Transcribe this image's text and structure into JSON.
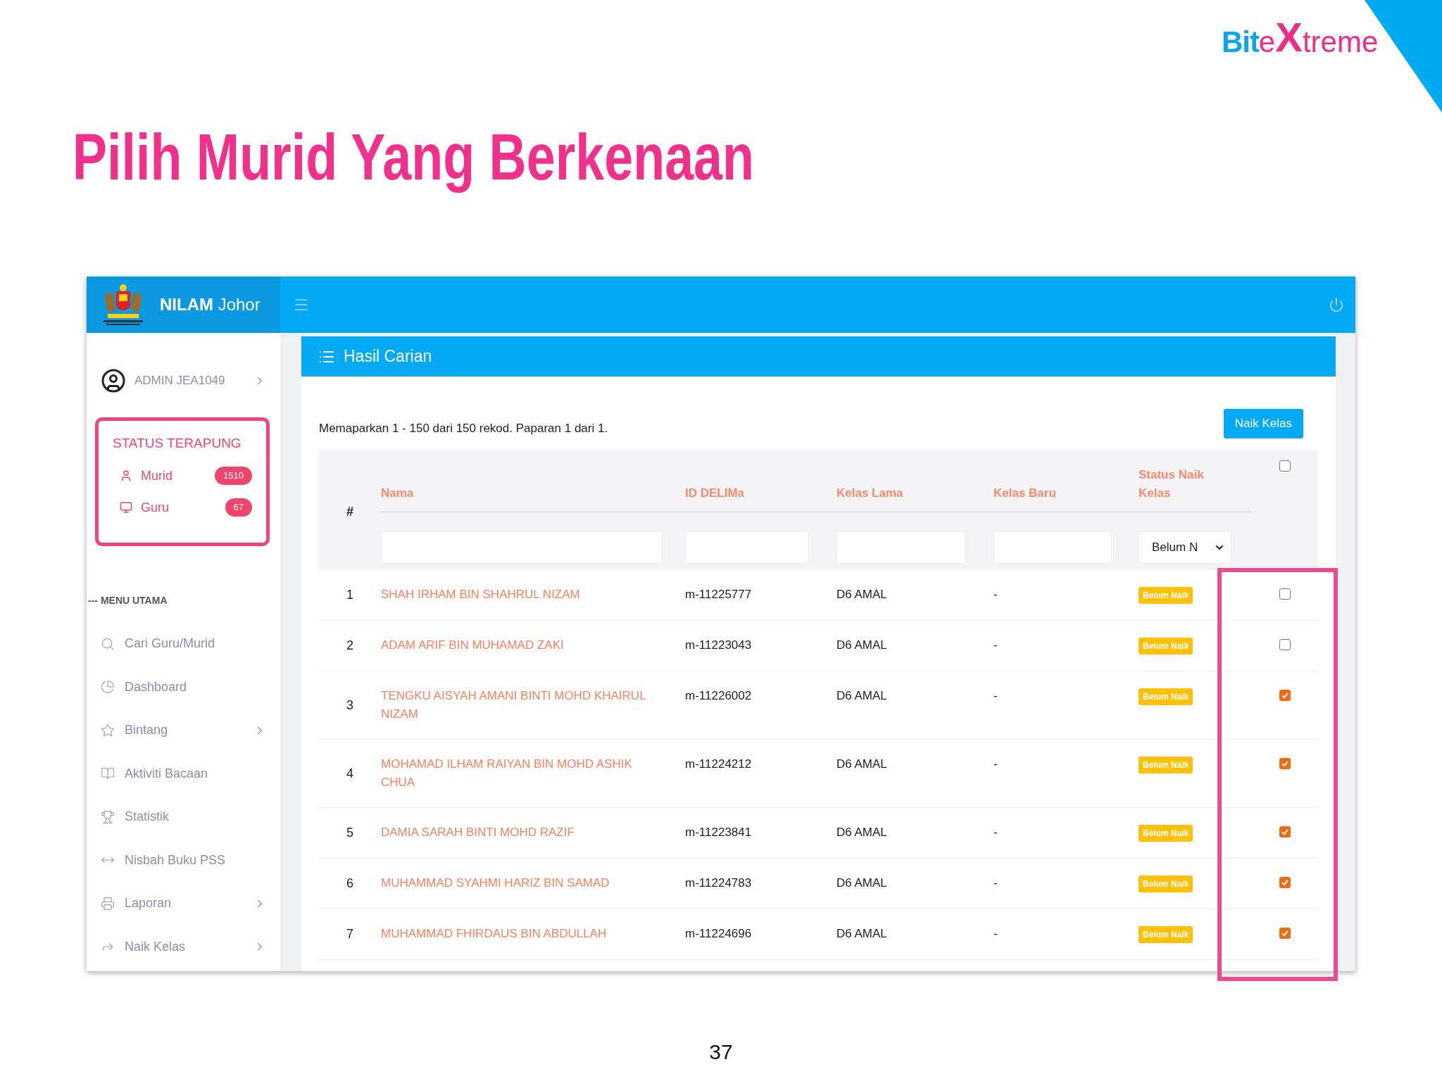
{
  "slide": {
    "title": "Pilih Murid Yang Berkenaan",
    "page_number": "37",
    "logo": {
      "part_1": "Bit",
      "part_2": "e",
      "part_3": "X",
      "part_4": "treme"
    }
  },
  "app": {
    "brand_bold": "NILAM",
    "brand_rest": "Johor",
    "user": "ADMIN JEA1049",
    "floating_status": {
      "title": "STATUS TERAPUNG",
      "items": [
        {
          "kind": "murid",
          "label": "Murid",
          "count": "1510"
        },
        {
          "kind": "guru",
          "label": "Guru",
          "count": "67"
        }
      ]
    },
    "menu_heading": "--- MENU UTAMA",
    "menu": [
      {
        "kind": "search",
        "label": "Cari Guru/Murid",
        "has_submenu": false
      },
      {
        "kind": "dashboard",
        "label": "Dashboard",
        "has_submenu": false
      },
      {
        "kind": "star",
        "label": "Bintang",
        "has_submenu": true
      },
      {
        "kind": "book",
        "label": "Aktiviti Bacaan",
        "has_submenu": false
      },
      {
        "kind": "trophy",
        "label": "Statistik",
        "has_submenu": false
      },
      {
        "kind": "ratio",
        "label": "Nisbah Buku PSS",
        "has_submenu": false
      },
      {
        "kind": "printer",
        "label": "Laporan",
        "has_submenu": true
      },
      {
        "kind": "share",
        "label": "Naik Kelas",
        "has_submenu": true
      }
    ]
  },
  "panel": {
    "title": "Hasil Carian",
    "summary": "Memaparkan 1 - 150 dari 150 rekod. Paparan 1 dari 1.",
    "button": "Naik Kelas",
    "columns": [
      "#",
      "Nama",
      "ID DELIMa",
      "Kelas Lama",
      "Kelas Baru",
      "Status Naik Kelas"
    ],
    "select_all_checked": false,
    "status_filter": "Belum N",
    "rows": [
      {
        "number": "1",
        "name": "SHAH IRHAM BIN SHAHRUL NIZAM",
        "id": "m-11225777",
        "kelas_lama": "D6 AMAL",
        "kelas_baru": "-",
        "status": "Belum Naik",
        "checked": false
      },
      {
        "number": "2",
        "name": "ADAM ARIF BIN MUHAMAD ZAKI",
        "id": "m-11223043",
        "kelas_lama": "D6 AMAL",
        "kelas_baru": "-",
        "status": "Belum Naik",
        "checked": false
      },
      {
        "number": "3",
        "name": "TENGKU AISYAH AMANI BINTI MOHD KHAIRUL NIZAM",
        "id": "m-11226002",
        "kelas_lama": "D6 AMAL",
        "kelas_baru": "-",
        "status": "Belum Naik",
        "checked": true
      },
      {
        "number": "4",
        "name": "MOHAMAD ILHAM RAIYAN BIN MOHD ASHIK CHUA",
        "id": "m-11224212",
        "kelas_lama": "D6 AMAL",
        "kelas_baru": "-",
        "status": "Belum Naik",
        "checked": true
      },
      {
        "number": "5",
        "name": "DAMIA SARAH BINTI MOHD RAZIF",
        "id": "m-11223841",
        "kelas_lama": "D6 AMAL",
        "kelas_baru": "-",
        "status": "Belum Naik",
        "checked": true
      },
      {
        "number": "6",
        "name": "MUHAMMAD SYAHMI HARIZ BIN SAMAD",
        "id": "m-11224783",
        "kelas_lama": "D6 AMAL",
        "kelas_baru": "-",
        "status": "Belum Naik",
        "checked": true
      },
      {
        "number": "7",
        "name": "MUHAMMAD FHIRDAUS BIN ABDULLAH",
        "id": "m-11224696",
        "kelas_lama": "D6 AMAL",
        "kelas_baru": "-",
        "status": "Belum Naik",
        "checked": true
      }
    ]
  }
}
